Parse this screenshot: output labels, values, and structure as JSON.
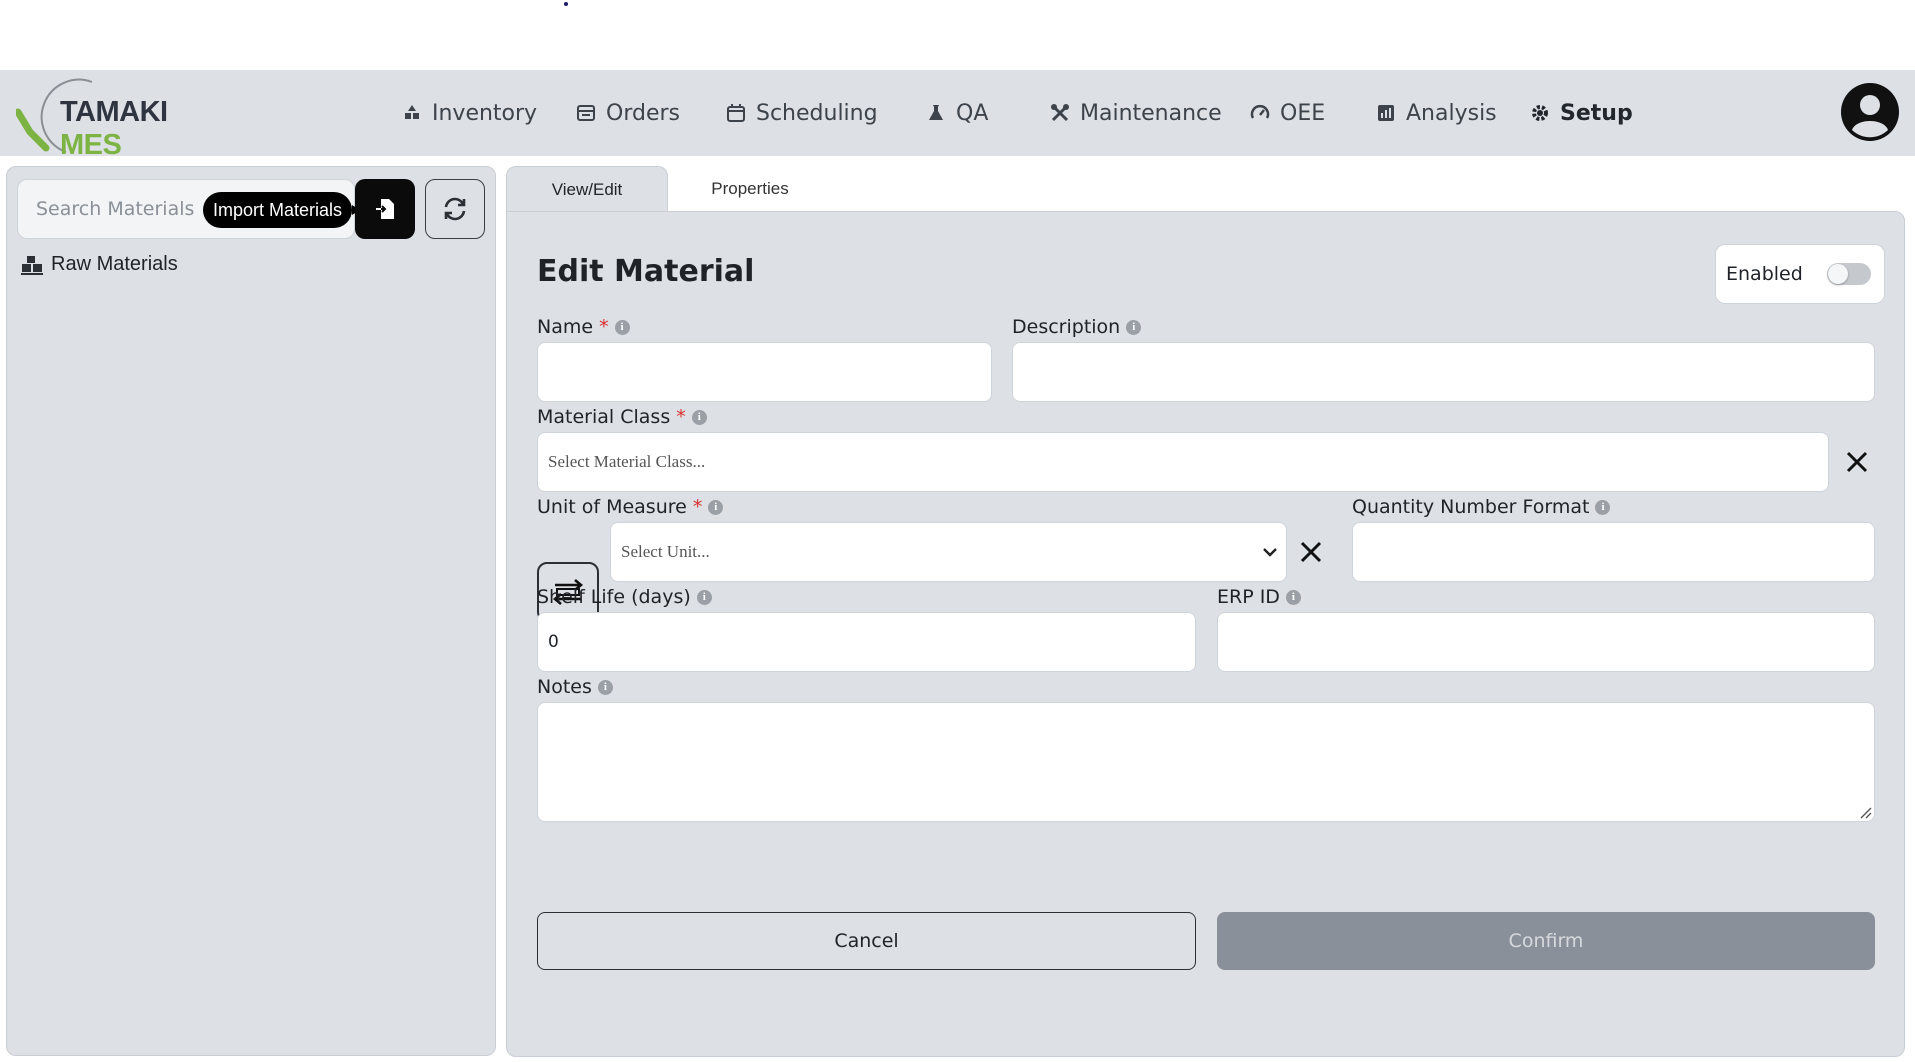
{
  "app": {
    "logo_left": "TAMAKI",
    "logo_right": "MES",
    "brand_green": "#7cb342"
  },
  "nav": {
    "items": [
      {
        "label": "Inventory",
        "icon": "boxes-icon"
      },
      {
        "label": "Orders",
        "icon": "orders-icon"
      },
      {
        "label": "Scheduling",
        "icon": "calendar-icon"
      },
      {
        "label": "QA",
        "icon": "flask-icon"
      },
      {
        "label": "Maintenance",
        "icon": "tools-icon"
      },
      {
        "label": "OEE",
        "icon": "gauge-icon"
      },
      {
        "label": "Analysis",
        "icon": "chart-icon"
      },
      {
        "label": "Setup",
        "icon": "gear-icon"
      }
    ],
    "active": "Setup"
  },
  "sidebar": {
    "search_placeholder": "Search Materials",
    "tooltip": "Import Materials",
    "tree": [
      {
        "label": "Raw Materials",
        "icon": "pallet-icon"
      }
    ]
  },
  "tabs": [
    {
      "label": "View/Edit",
      "active": true
    },
    {
      "label": "Properties",
      "active": false
    }
  ],
  "form": {
    "title": "Edit Material",
    "enabled_label": "Enabled",
    "enabled": false,
    "name_label": "Name",
    "description_label": "Description",
    "material_class_label": "Material Class",
    "material_class_placeholder": "Select Material Class...",
    "uom_label": "Unit of Measure",
    "uom_placeholder": "Select Unit...",
    "qty_format_label": "Quantity Number Format",
    "shelf_life_label": "Shelf Life (days)",
    "shelf_life_value": "0",
    "erp_id_label": "ERP ID",
    "notes_label": "Notes",
    "required_mark": "*",
    "info_mark": "i",
    "cancel_label": "Cancel",
    "confirm_label": "Confirm"
  }
}
